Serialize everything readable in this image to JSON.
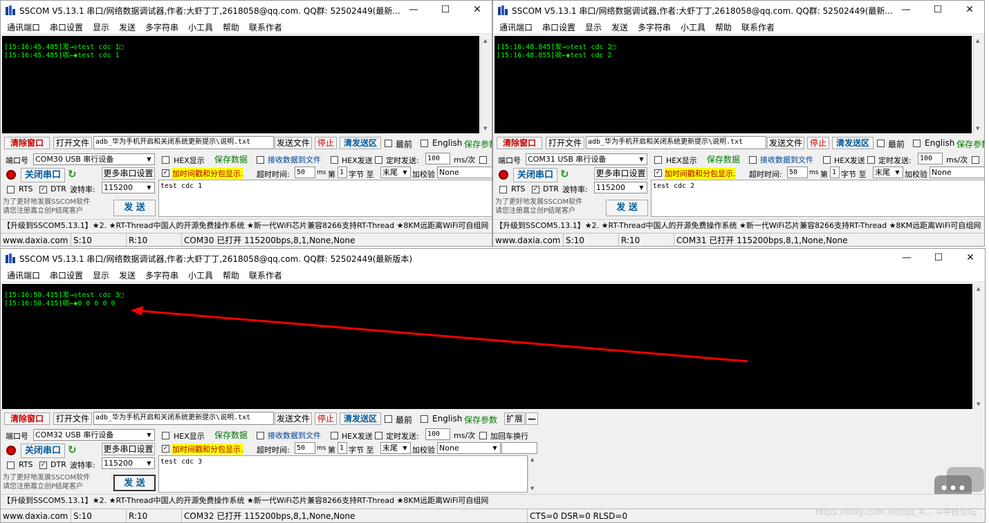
{
  "app_title": "SSCOM V5.13.1 串口/网络数据调试器,作者:大虾丁丁,2618058@qq.com. QQ群: 52502449(最新版本)",
  "app_title_short": "SSCOM V5.13.1 串口/网络数据调试器,作者:大虾丁丁,2618058@qq.com. QQ群: 52502449(最新...",
  "title_buttons": {
    "minimize": "—",
    "maximize": "☐",
    "close": "✕"
  },
  "menu": [
    "通讯端口",
    "串口设置",
    "显示",
    "发送",
    "多字符串",
    "小工具",
    "帮助",
    "联系作者"
  ],
  "controls": {
    "clear_window": "清除窗口",
    "open_file": "打开文件",
    "file_path": "adb_华为手机开启和关闭系统更新提示\\说明.txt",
    "send_file": "发送文件",
    "stop": "停止",
    "clear_send": "清发送区",
    "topmost": "最前",
    "english": "English",
    "save_params": "保存参数",
    "expand": "扩展",
    "collapse": "—",
    "port_label": "端口号",
    "close_port": "关闭串口",
    "more_settings": "更多串口设置",
    "rts": "RTS",
    "dtr": "DTR",
    "baud_label": "波特率:",
    "baud": "115200",
    "hex_display": "HEX显示",
    "save_data": "保存数据",
    "recv_to_file": "接收数据到文件",
    "hex_send": "HEX发送",
    "timed_send": "定时发送:",
    "timed_value": "100",
    "timed_unit": "ms/次",
    "add_crlf": "加回车换行",
    "timestamp": "加时间戳和分包显示.",
    "timeout_label": "超时时间:",
    "timeout_value": "50",
    "ms": "ms",
    "nth_label": "第",
    "nth_value": "1",
    "byte_label": "字节 至",
    "end_value": "末尾",
    "checksum_label": "加校验",
    "checksum_value": "None",
    "send": "发 送",
    "promo_line1": "为了更好地发展SSCOM软件",
    "promo_line2": "请您注册嘉立创P结尾客户"
  },
  "ticker": "【升级到SSCOM5.13.1】★2. ★RT-Thread中国人的开源免费操作系统 ★新一代WiFi芯片兼容8266支持RT-Thread ★8KM远距离WiFi可自组网",
  "windows": [
    {
      "port": "COM30 USB 串行设备",
      "log": [
        "[15:16:45.485]发→◇test cdc 1□",
        "[15:16:45.485]收←◆test cdc 1"
      ],
      "send_text": "test cdc 1",
      "status": {
        "site": "www.daxia.com",
        "sent": "S:10",
        "recv": "R:10",
        "port_info": "COM30 已打开  115200bps,8,1,None,None"
      }
    },
    {
      "port": "COM31 USB 串行设备",
      "log": [
        "[15:16:48.845]发→◇test cdc 2□",
        "[15:16:48.855]收←◆test cdc 2"
      ],
      "send_text": "test cdc 2",
      "status": {
        "site": "www.daxia.com",
        "sent": "S:10",
        "recv": "R:10",
        "port_info": "COM31 已打开  115200bps,8,1,None,None"
      }
    },
    {
      "port": "COM32 USB 串行设备",
      "log": [
        "[15:16:50.415]发→◇test cdc 3□",
        "[15:16:50.415]收←◆0 0 0 0 0"
      ],
      "send_text": "test cdc 3",
      "status": {
        "site": "www.daxia.com",
        "sent": "S:10",
        "recv": "R:10",
        "port_info": "COM32 已打开  115200bps,8,1,None,None",
        "lines": "CTS=0 DSR=0 RLSD=0"
      }
    }
  ],
  "watermark": "https://blog.csdn.net/qq_4... 斗中技论坛",
  "colors": {
    "terminal_bg": "#000000",
    "terminal_text": "#00ff00",
    "arrow": "#ff0000",
    "highlight": "#ffff00"
  }
}
